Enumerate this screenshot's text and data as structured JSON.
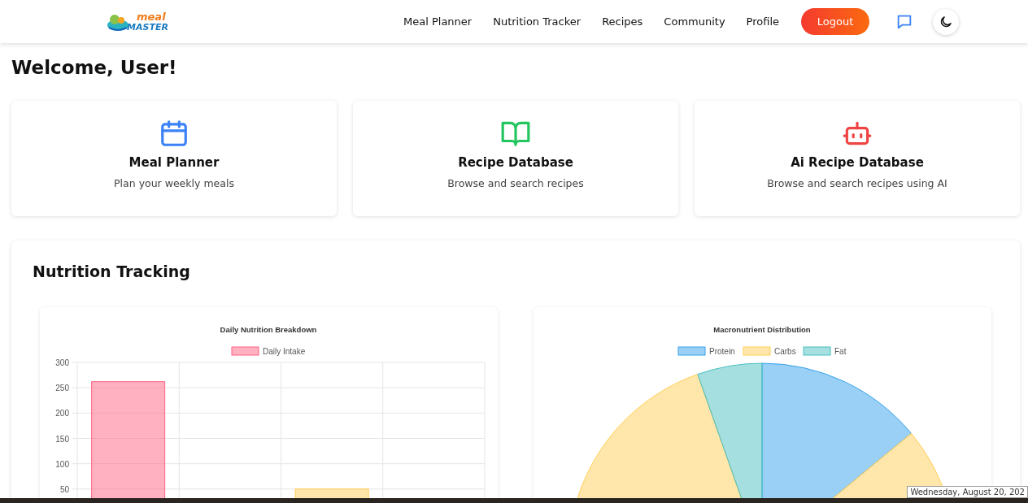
{
  "logo": {
    "line_1": "meal",
    "line_2": "MASTER"
  },
  "nav": {
    "links": [
      "Meal Planner",
      "Nutrition Tracker",
      "Recipes",
      "Community",
      "Profile"
    ],
    "logout": "Logout"
  },
  "welcome": "Welcome, User!",
  "cards": [
    {
      "kind": "calendar",
      "title": "Meal Planner",
      "text": "Plan your weekly meals",
      "color": "#3b82f6"
    },
    {
      "kind": "book",
      "title": "Recipe Database",
      "text": "Browse and search recipes",
      "color": "#22c55e"
    },
    {
      "kind": "robot",
      "title": "Ai Recipe Database",
      "text": "Browse and search recipes using AI",
      "color": "#ef4444"
    }
  ],
  "nutrition": {
    "title": "Nutrition Tracking",
    "charts": [
      {
        "chart_data": {
          "type": "bar",
          "title": "Daily Nutrition Breakdown",
          "series": [
            {
              "name": "Daily Intake",
              "values": [
                262,
                null,
                50,
                null
              ]
            }
          ],
          "colors": [
            "#ff6384",
            null,
            "#ffce56",
            null
          ],
          "grid": true,
          "legend": true,
          "ylim": [
            0,
            300
          ],
          "yticks": [
            50,
            100,
            150,
            200,
            250,
            300
          ]
        }
      },
      {
        "chart_data": {
          "type": "pie",
          "title": "Macronutrient Distribution",
          "categories": [
            "Protein",
            "Carbs",
            "Fat"
          ],
          "values": [
            14,
            80.6,
            5.4
          ],
          "colors": [
            "#36a2eb",
            "#ffce56",
            "#4bc0c0"
          ],
          "legend": true
        }
      }
    ]
  },
  "taskbar": {
    "tooltip": "Wednesday, August 20, 202"
  }
}
